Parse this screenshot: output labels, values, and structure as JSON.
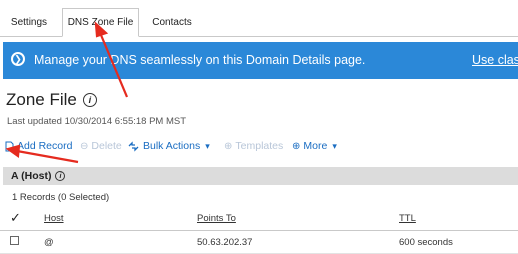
{
  "tabs": [
    {
      "label": "Settings"
    },
    {
      "label": "DNS Zone File",
      "active": true
    },
    {
      "label": "Contacts"
    }
  ],
  "banner": {
    "message": "Manage your DNS seamlessly on this Domain Details page.",
    "link": "Use classi",
    "color": "#2b88d8"
  },
  "page": {
    "title": "Zone File",
    "updated": "Last updated 10/30/2014 6:55:18 PM MST"
  },
  "toolbar": {
    "add_record": "Add Record",
    "delete": "Delete",
    "bulk_actions": "Bulk Actions",
    "templates": "Templates",
    "more": "More"
  },
  "section": {
    "title": "A (Host)",
    "count": "1 Records (0 Selected)"
  },
  "table": {
    "headers": [
      "Host",
      "Points To",
      "TTL"
    ],
    "rows": [
      {
        "host": "@",
        "points_to": "50.63.202.37",
        "ttl": "600 seconds"
      }
    ]
  },
  "annotation_color": "#e52b1f"
}
